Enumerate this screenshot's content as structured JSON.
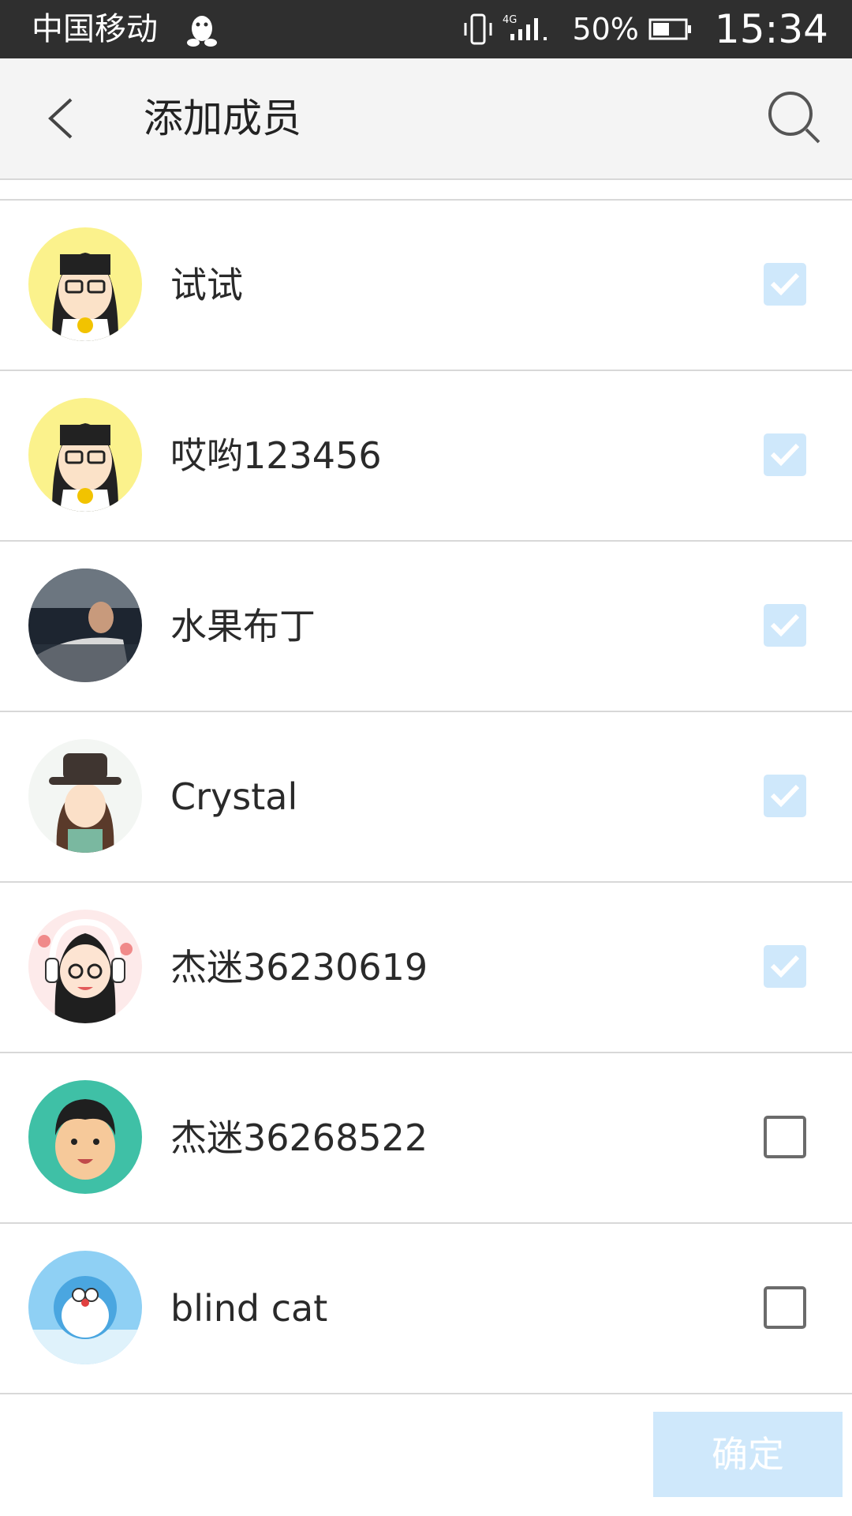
{
  "status_bar": {
    "carrier": "中国移动",
    "network": "4G",
    "battery_percent": "50%",
    "time": "15:34"
  },
  "header": {
    "title": "添加成员",
    "back_icon": "chevron-left-icon",
    "search_icon": "search-icon"
  },
  "members": [
    {
      "name": "试试",
      "checked": true
    },
    {
      "name": "哎哟123456",
      "checked": true
    },
    {
      "name": "水果布丁",
      "checked": true
    },
    {
      "name": "Crystal",
      "checked": true
    },
    {
      "name": "杰迷36230619",
      "checked": true
    },
    {
      "name": "杰迷36268522",
      "checked": false
    },
    {
      "name": "blind cat",
      "checked": false
    }
  ],
  "footer": {
    "confirm_label": "确定"
  },
  "colors": {
    "status_bar_bg": "#2f2f2f",
    "header_bg": "#f4f4f4",
    "checked_bg": "#cfe8fb",
    "confirm_bg": "#cfe8fb"
  }
}
